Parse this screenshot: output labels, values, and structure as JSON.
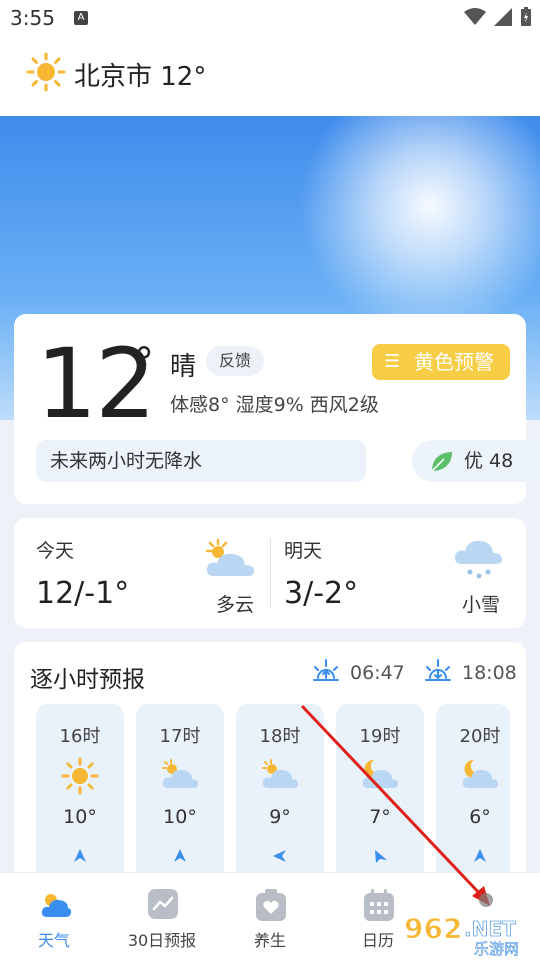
{
  "status": {
    "time": "3:55",
    "a_icon": "A"
  },
  "header": {
    "city_temp": "北京市 12°"
  },
  "current": {
    "temp": "12",
    "deg": "°",
    "condition": "晴",
    "feedback": "反馈",
    "warning_label": "黄色预警",
    "details": "体感8°  湿度9%  西风2级",
    "rain": "未来两小时无降水",
    "aqi": "优 48"
  },
  "days": [
    {
      "label": "今天",
      "temp": "12/-1°",
      "condition": "多云",
      "icon": "partly-cloudy-icon"
    },
    {
      "label": "明天",
      "temp": "3/-2°",
      "condition": "小雪",
      "icon": "light-snow-icon"
    }
  ],
  "hourly": {
    "title": "逐小时预报",
    "sunrise": "06:47",
    "sunset": "18:08",
    "items": [
      {
        "time": "16时",
        "temp": "10°",
        "icon": "sun-icon"
      },
      {
        "time": "17时",
        "temp": "10°",
        "icon": "partly-cloudy-icon"
      },
      {
        "time": "18时",
        "temp": "9°",
        "icon": "partly-cloudy-icon"
      },
      {
        "time": "19时",
        "temp": "7°",
        "icon": "partly-cloudy-night-icon"
      },
      {
        "time": "20时",
        "temp": "6°",
        "icon": "partly-cloudy-night-icon"
      }
    ]
  },
  "nav": [
    {
      "label": "天气",
      "icon": "weather-icon",
      "active": true
    },
    {
      "label": "30日预报",
      "icon": "trend-icon",
      "active": false
    },
    {
      "label": "养生",
      "icon": "health-icon",
      "active": false
    },
    {
      "label": "日历",
      "icon": "calendar-icon",
      "active": false
    }
  ],
  "watermark": {
    "text1": "962",
    "text2": ".NET",
    "text3": "乐游网"
  },
  "colors": {
    "accent": "#3a8ef0",
    "warning": "#f7cd46",
    "sun": "#f7b733"
  }
}
